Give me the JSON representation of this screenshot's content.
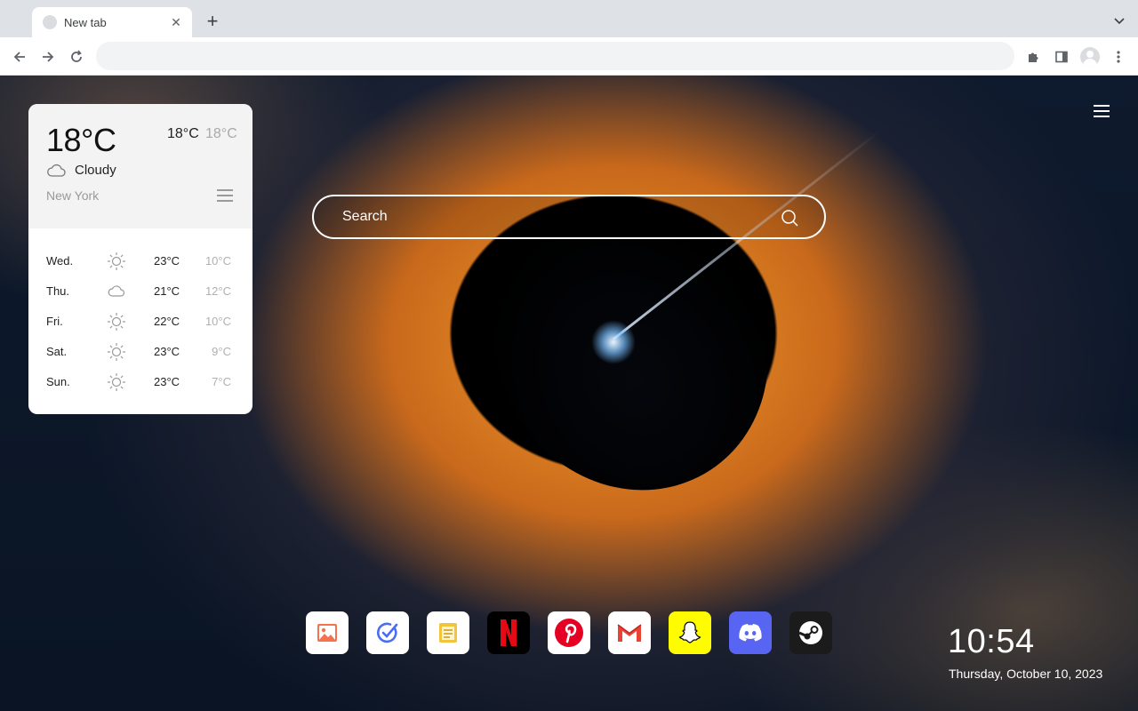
{
  "browser": {
    "tab_title": "New tab",
    "tab_close": "✕",
    "new_tab": "+",
    "address_value": "",
    "address_placeholder": ""
  },
  "weather": {
    "temp": "18°C",
    "high": "18°C",
    "low": "18°C",
    "condition": "Cloudy",
    "city": "New York",
    "forecast": [
      {
        "day": "Wed.",
        "icon": "sun-icon",
        "max": "23°C",
        "min": "10°C"
      },
      {
        "day": "Thu.",
        "icon": "cloud-icon",
        "max": "21°C",
        "min": "12°C"
      },
      {
        "day": "Fri.",
        "icon": "sun-icon",
        "max": "22°C",
        "min": "10°C"
      },
      {
        "day": "Sat.",
        "icon": "sun-icon",
        "max": "23°C",
        "min": "9°C"
      },
      {
        "day": "Sun.",
        "icon": "sun-icon",
        "max": "23°C",
        "min": "7°C"
      }
    ]
  },
  "search": {
    "placeholder": "Search"
  },
  "apps": [
    {
      "name": "photos-app",
      "icon": "image-icon",
      "bg": "#ffffff"
    },
    {
      "name": "tasks-app",
      "icon": "check-circle-icon",
      "bg": "#ffffff"
    },
    {
      "name": "notes-app",
      "icon": "notes-icon",
      "bg": "#ffffff"
    },
    {
      "name": "netflix-app",
      "icon": "netflix-icon",
      "bg": "#000000"
    },
    {
      "name": "pinterest-app",
      "icon": "pinterest-icon",
      "bg": "#ffffff"
    },
    {
      "name": "gmail-app",
      "icon": "gmail-icon",
      "bg": "#ffffff"
    },
    {
      "name": "snapchat-app",
      "icon": "snapchat-icon",
      "bg": "#fffc00"
    },
    {
      "name": "discord-app",
      "icon": "discord-icon",
      "bg": "#5865f2"
    },
    {
      "name": "steam-app",
      "icon": "steam-icon",
      "bg": "#1b1b1b"
    }
  ],
  "clock": {
    "time": "10:54",
    "date": "Thursday, October 10, 2023"
  },
  "colors": {
    "accent_netflix": "#e50914",
    "pinterest": "#e60023",
    "discord": "#5865f2",
    "snapchat": "#fffc00"
  }
}
